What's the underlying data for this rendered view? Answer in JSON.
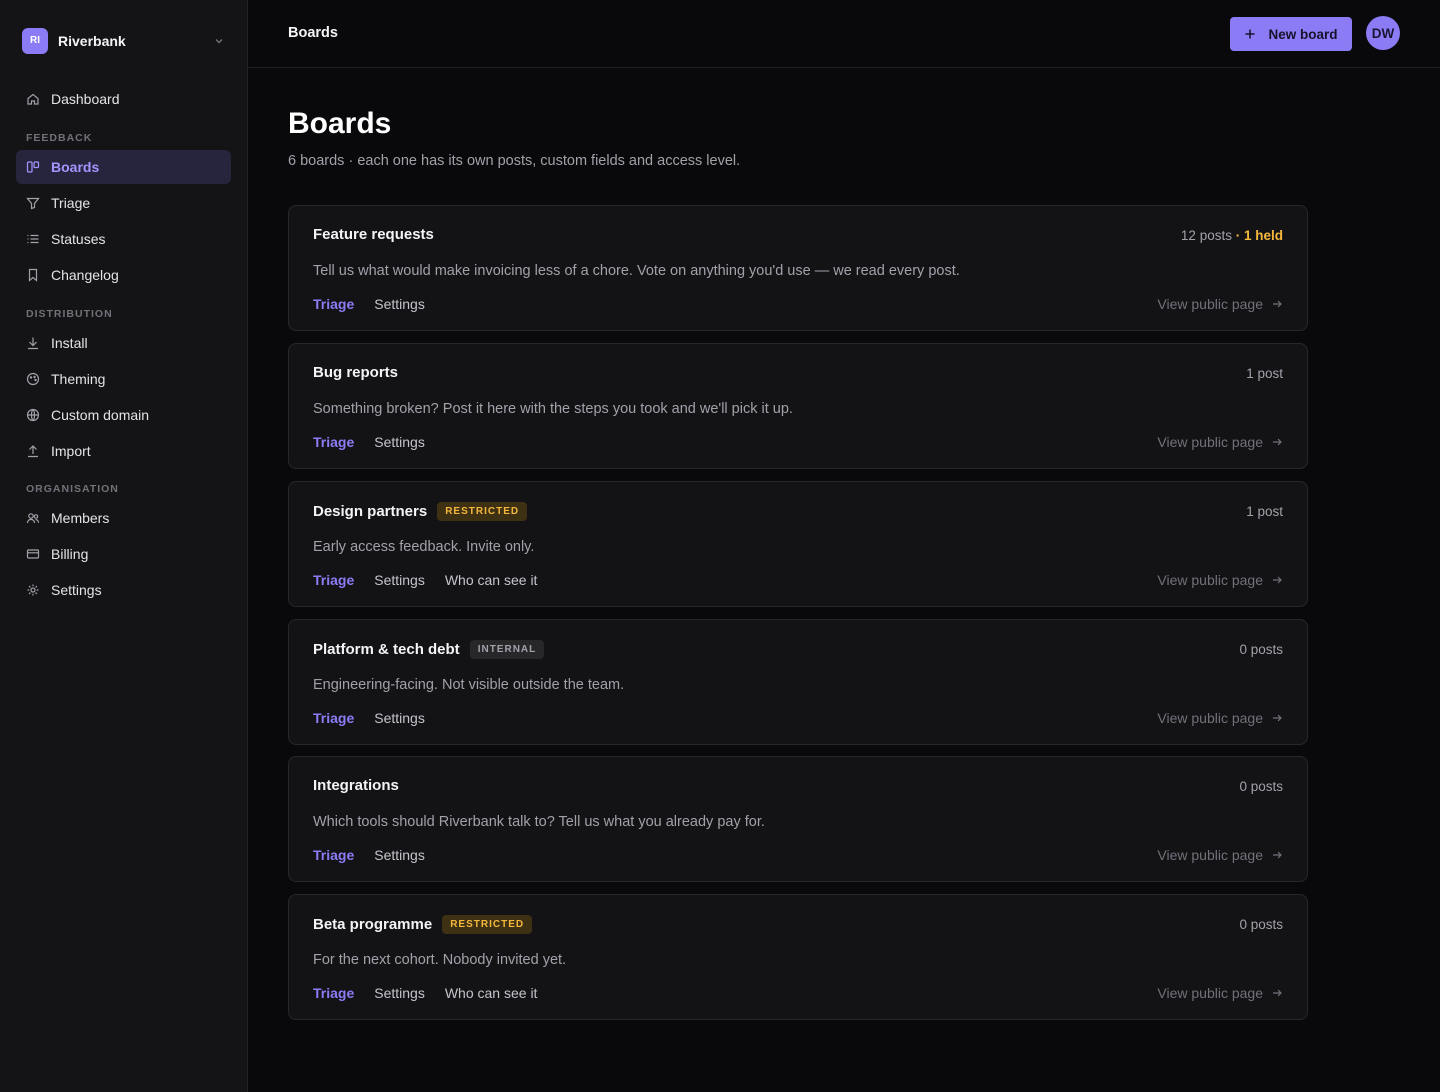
{
  "workspace": {
    "initials": "RI",
    "name": "Riverbank"
  },
  "nav": {
    "dashboard": "Dashboard",
    "section_feedback": "FEEDBACK",
    "boards": "Boards",
    "triage": "Triage",
    "statuses": "Statuses",
    "changelog": "Changelog",
    "section_distribution": "DISTRIBUTION",
    "install": "Install",
    "theming": "Theming",
    "custom_domain": "Custom domain",
    "import": "Import",
    "section_organisation": "ORGANISATION",
    "members": "Members",
    "billing": "Billing",
    "settings": "Settings"
  },
  "header": {
    "breadcrumb": "Boards",
    "new_board_label": "New board",
    "avatar_initials": "DW"
  },
  "page": {
    "title": "Boards",
    "subtitle": "6 boards · each one has its own posts, custom fields and access level."
  },
  "boards": [
    {
      "name": "Feature requests",
      "badge": "",
      "count": "12 posts",
      "held": "· 1 held",
      "description": "Tell us what would make invoicing less of a chore. Vote on anything you'd use — we read every post.",
      "links": [
        "Triage",
        "Settings"
      ],
      "view": "View public page"
    },
    {
      "name": "Bug reports",
      "badge": "",
      "count": "1 post",
      "held": "",
      "description": "Something broken? Post it here with the steps you took and we'll pick it up.",
      "links": [
        "Triage",
        "Settings"
      ],
      "view": "View public page"
    },
    {
      "name": "Design partners",
      "badge": "RESTRICTED",
      "count": "1 post",
      "held": "",
      "description": "Early access feedback. Invite only.",
      "links": [
        "Triage",
        "Settings",
        "Who can see it"
      ],
      "view": "View public page"
    },
    {
      "name": "Platform & tech debt",
      "badge": "INTERNAL",
      "count": "0 posts",
      "held": "",
      "description": "Engineering-facing. Not visible outside the team.",
      "links": [
        "Triage",
        "Settings"
      ],
      "view": "View public page"
    },
    {
      "name": "Integrations",
      "badge": "",
      "count": "0 posts",
      "held": "",
      "description": "Which tools should Riverbank talk to? Tell us what you already pay for.",
      "links": [
        "Triage",
        "Settings"
      ],
      "view": "View public page"
    },
    {
      "name": "Beta programme",
      "badge": "RESTRICTED",
      "count": "0 posts",
      "held": "",
      "description": "For the next cohort. Nobody invited yet.",
      "links": [
        "Triage",
        "Settings",
        "Who can see it"
      ],
      "view": "View public page"
    }
  ]
}
